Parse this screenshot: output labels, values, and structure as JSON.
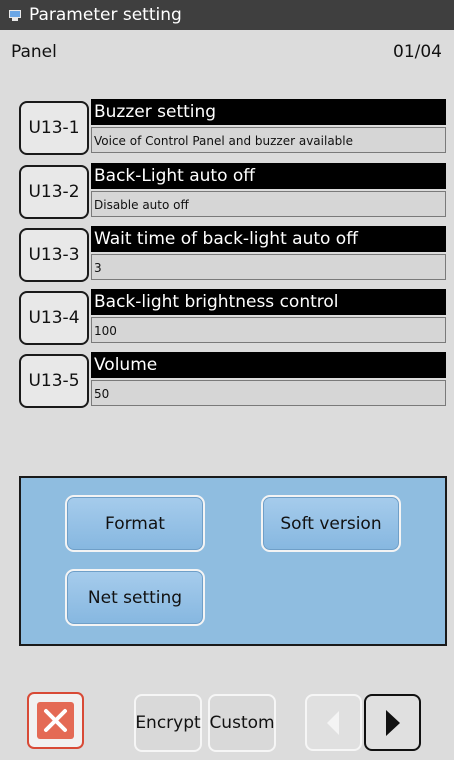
{
  "window": {
    "title": "Parameter setting",
    "icon": "monitor-icon"
  },
  "header": {
    "section": "Panel",
    "page": "01/04"
  },
  "params": [
    {
      "code": "U13-1",
      "title": "Buzzer setting",
      "value": "Voice of Control Panel and buzzer available"
    },
    {
      "code": "U13-2",
      "title": "Back-Light auto off",
      "value": "Disable auto off"
    },
    {
      "code": "U13-3",
      "title": "Wait time of back-light auto off",
      "value": "3"
    },
    {
      "code": "U13-4",
      "title": "Back-light brightness control",
      "value": "100"
    },
    {
      "code": "U13-5",
      "title": "Volume",
      "value": "50"
    }
  ],
  "panel": {
    "format": "Format",
    "soft_version": "Soft version",
    "net_setting": "Net setting"
  },
  "footer": {
    "close_icon": "close-icon",
    "encrypt": "Encrypt",
    "custom": "Custom",
    "prev_icon": "triangle-left-icon",
    "next_icon": "triangle-right-icon"
  },
  "colors": {
    "titlebar": "#3f3f3f",
    "panel": "#8fbde0",
    "close_border": "#d84a36"
  }
}
